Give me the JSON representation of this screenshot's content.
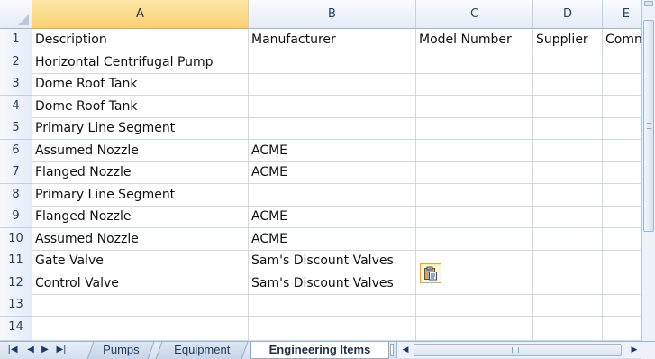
{
  "columns": [
    "A",
    "B",
    "C",
    "D",
    "E"
  ],
  "selected_column": "A",
  "rows": [
    {
      "num": "1",
      "cells": [
        "Description",
        "Manufacturer",
        "Model Number",
        "Supplier",
        "Comn"
      ]
    },
    {
      "num": "2",
      "cells": [
        "Horizontal Centrifugal Pump",
        "",
        "",
        "",
        ""
      ]
    },
    {
      "num": "3",
      "cells": [
        "Dome Roof Tank",
        "",
        "",
        "",
        ""
      ]
    },
    {
      "num": "4",
      "cells": [
        "Dome Roof Tank",
        "",
        "",
        "",
        ""
      ]
    },
    {
      "num": "5",
      "cells": [
        "Primary Line Segment",
        "",
        "",
        "",
        ""
      ]
    },
    {
      "num": "6",
      "cells": [
        "Assumed Nozzle",
        "ACME",
        "",
        "",
        ""
      ]
    },
    {
      "num": "7",
      "cells": [
        "Flanged Nozzle",
        "ACME",
        "",
        "",
        ""
      ]
    },
    {
      "num": "8",
      "cells": [
        "Primary Line Segment",
        "",
        "",
        "",
        ""
      ]
    },
    {
      "num": "9",
      "cells": [
        "Flanged Nozzle",
        "ACME",
        "",
        "",
        ""
      ]
    },
    {
      "num": "10",
      "cells": [
        "Assumed Nozzle",
        "ACME",
        "",
        "",
        ""
      ]
    },
    {
      "num": "11",
      "cells": [
        "Gate Valve",
        "Sam's Discount Valves",
        "",
        "",
        ""
      ]
    },
    {
      "num": "12",
      "cells": [
        "Control Valve",
        "Sam's Discount Valves",
        "",
        "",
        ""
      ]
    },
    {
      "num": "13",
      "cells": [
        "",
        "",
        "",
        "",
        ""
      ]
    },
    {
      "num": "14",
      "cells": [
        "",
        "",
        "",
        "",
        ""
      ]
    }
  ],
  "sheet_tabs": [
    {
      "label": "Pumps",
      "active": false
    },
    {
      "label": "Equipment",
      "active": false
    },
    {
      "label": "Engineering Items",
      "active": true
    }
  ],
  "paste_icon": "paste-options-icon",
  "colors": {
    "header_bg": "#e4ecf7",
    "selected_header_bg": "#f9cf73",
    "grid_line": "#d0d7e5",
    "paste_border": "#e6a33c"
  }
}
